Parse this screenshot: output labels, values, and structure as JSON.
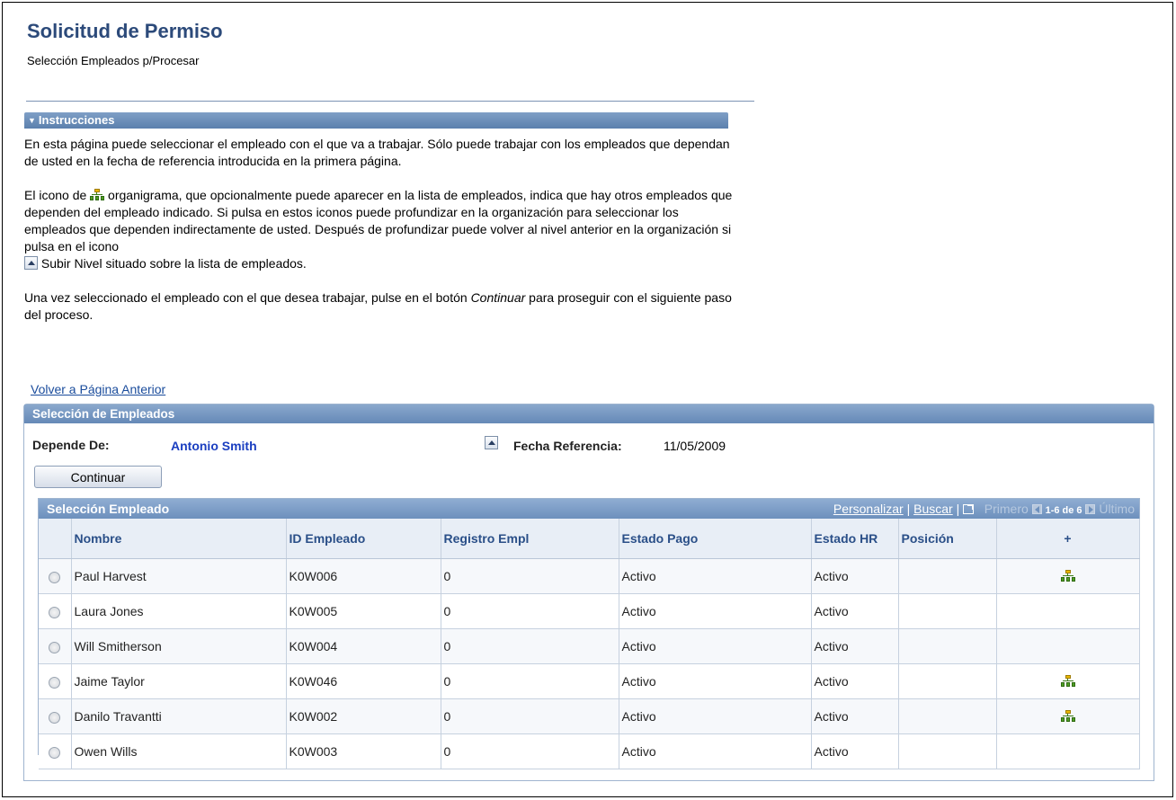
{
  "page": {
    "title": "Solicitud de Permiso",
    "subtitle": "Selección Empleados p/Procesar"
  },
  "instructions": {
    "header": "Instrucciones",
    "p1": "En esta página puede seleccionar el empleado con el que va a trabajar. Sólo puede trabajar con los empleados que dependan de usted en la fecha de referencia introducida en la primera página.",
    "p2_before": "El icono de ",
    "p2_after": " organigrama, que opcionalmente puede aparecer en la lista de empleados, indica que hay otros empleados que dependen del empleado indicado. Si pulsa en estos iconos puede profundizar en la organización para seleccionar los empleados que dependen indirectamente de usted. Después de profundizar puede volver al nivel anterior en la organización si pulsa en el icono",
    "p2_end": " Subir Nivel situado sobre la lista de empleados.",
    "p3_before": "Una vez seleccionado el empleado con el que desea trabajar, pulse en el botón ",
    "p3_italic": "Continuar",
    "p3_after": " para proseguir con el siguiente paso del proceso."
  },
  "back_link": "Volver a Página Anterior",
  "selection": {
    "header": "Selección de Empleados",
    "depends_label": "Depende De:",
    "depends_value": "Antonio Smith",
    "ref_date_label": "Fecha Referencia:",
    "ref_date_value": "11/05/2009",
    "continue_label": "Continuar"
  },
  "grid": {
    "title": "Selección Empleado",
    "nav": {
      "personalize": "Personalizar",
      "find": "Buscar",
      "first": "Primero",
      "range": "1-6 de 6",
      "last": "Último"
    },
    "columns": [
      "Nombre",
      "ID Empleado",
      "Registro Empl",
      "Estado Pago",
      "Estado HR",
      "Posición",
      "+"
    ],
    "rows": [
      {
        "name": "Paul Harvest",
        "id": "K0W006",
        "record": "0",
        "pay_status": "Activo",
        "hr_status": "Activo",
        "position": "",
        "org": true
      },
      {
        "name": "Laura Jones",
        "id": "K0W005",
        "record": "0",
        "pay_status": "Activo",
        "hr_status": "Activo",
        "position": "",
        "org": false
      },
      {
        "name": "Will Smitherson",
        "id": "K0W004",
        "record": "0",
        "pay_status": "Activo",
        "hr_status": "Activo",
        "position": "",
        "org": false
      },
      {
        "name": "Jaime Taylor",
        "id": "K0W046",
        "record": "0",
        "pay_status": "Activo",
        "hr_status": "Activo",
        "position": "",
        "org": true
      },
      {
        "name": "Danilo Travantti",
        "id": "K0W002",
        "record": "0",
        "pay_status": "Activo",
        "hr_status": "Activo",
        "position": "",
        "org": true
      },
      {
        "name": "Owen Wills",
        "id": "K0W003",
        "record": "0",
        "pay_status": "Activo",
        "hr_status": "Activo",
        "position": "",
        "org": false
      }
    ]
  },
  "icons": {
    "org_chart": "org-chart-icon",
    "up_level": "up-level-icon"
  },
  "colors": {
    "title": "#2c4a7a",
    "header_bar": "#6589b7",
    "link": "#1a4c9c",
    "depends_value": "#1a3ec0"
  }
}
